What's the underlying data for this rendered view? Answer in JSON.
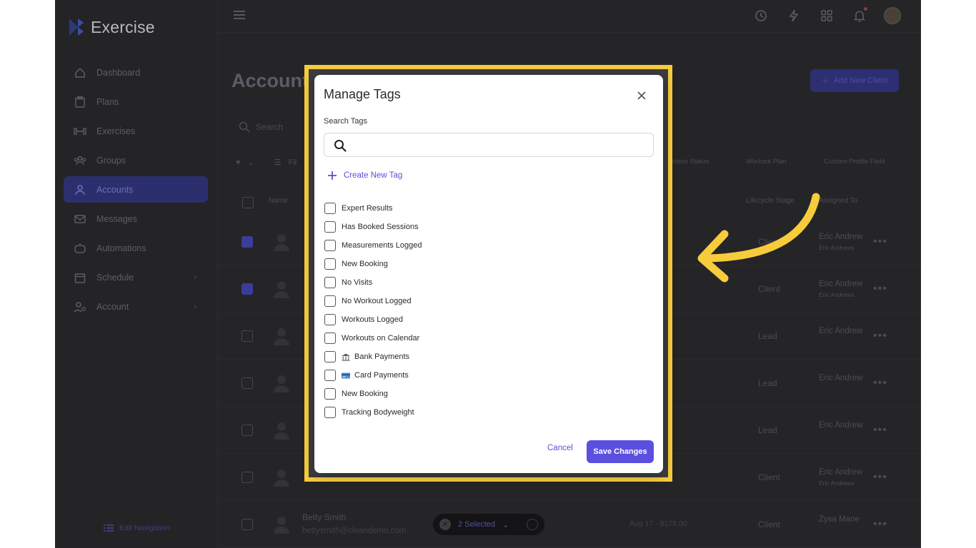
{
  "app": {
    "logo_text": "Exercise",
    "page_title": "Account",
    "add_client_label": "Add New Client",
    "search_placeholder": "Search",
    "filter_label": "Fil",
    "column_filters": [
      "Custom Status",
      "Workout Plan",
      "Custom Profile Field"
    ],
    "headers": {
      "name": "Name",
      "lifecycle": "Lifecycle Stage",
      "assigned": "Assigned To"
    },
    "edit_navigation": "Edit Navigation",
    "selected_label": "2 Selected",
    "bottom_date": "Aug 17 - $175.00"
  },
  "sidebar": {
    "items": [
      {
        "label": "Dashboard",
        "icon": "home-icon"
      },
      {
        "label": "Plans",
        "icon": "clipboard-icon"
      },
      {
        "label": "Exercises",
        "icon": "dumbbell-icon"
      },
      {
        "label": "Groups",
        "icon": "group-icon"
      },
      {
        "label": "Accounts",
        "icon": "user-icon",
        "active": true
      },
      {
        "label": "Messages",
        "icon": "mail-icon"
      },
      {
        "label": "Automations",
        "icon": "robot-icon"
      },
      {
        "label": "Schedule",
        "icon": "calendar-icon",
        "chevron": true
      },
      {
        "label": "Account",
        "icon": "user-settings-icon",
        "chevron": true
      }
    ]
  },
  "rows": [
    {
      "stage": "Client",
      "assigned": "Eric Andrew",
      "assigned_sub": "Eric Andrews",
      "checked": true
    },
    {
      "stage": "Client",
      "assigned": "Eric Andrew",
      "assigned_sub": "Eric Andrews",
      "checked": true
    },
    {
      "stage": "Lead",
      "assigned": "Eric Andrew",
      "assigned_sub": "",
      "checked": false
    },
    {
      "stage": "Lead",
      "assigned": "Eric Andrew",
      "assigned_sub": "",
      "checked": false
    },
    {
      "stage": "Lead",
      "assigned": "Eric Andrew",
      "assigned_sub": "",
      "checked": false
    },
    {
      "stage": "Client",
      "assigned": "Eric Andrew",
      "assigned_sub": "Eric Andrews",
      "checked": false
    },
    {
      "stage": "Client",
      "assigned": "Zysa Marie",
      "assigned_sub": "",
      "checked": false,
      "name": "Betty Smith",
      "email": "bettysmith@cleandemo.com"
    }
  ],
  "modal": {
    "title": "Manage Tags",
    "search_label": "Search Tags",
    "search_value": "",
    "create_label": "Create New Tag",
    "cancel_label": "Cancel",
    "save_label": "Save Changes",
    "tags": [
      {
        "label": "Expert Results",
        "emoji": ""
      },
      {
        "label": "Has Booked Sessions",
        "emoji": ""
      },
      {
        "label": "Measurements Logged",
        "emoji": ""
      },
      {
        "label": "New Booking",
        "emoji": ""
      },
      {
        "label": "No Visits",
        "emoji": ""
      },
      {
        "label": "No Workout Logged",
        "emoji": ""
      },
      {
        "label": "Workouts Logged",
        "emoji": ""
      },
      {
        "label": "Workouts on Calendar",
        "emoji": ""
      },
      {
        "label": "Bank Payments",
        "emoji": "bank-icon"
      },
      {
        "label": "Card Payments",
        "emoji": "credit-card-icon"
      },
      {
        "label": "New Booking",
        "emoji": ""
      },
      {
        "label": "Tracking Bodyweight",
        "emoji": ""
      }
    ]
  },
  "colors": {
    "accent": "#5b4fe0",
    "highlight": "#f7cc3b",
    "background": "#252528"
  }
}
